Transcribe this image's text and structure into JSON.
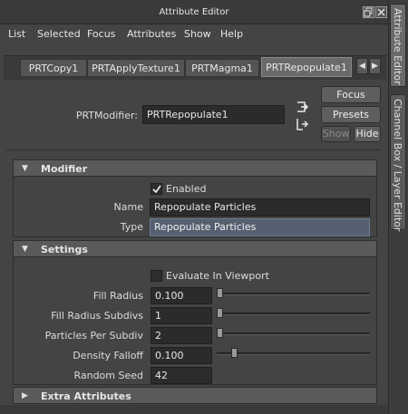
{
  "window": {
    "title": "Attribute Editor"
  },
  "side_tabs": {
    "attribute_editor": "Attribute Editor",
    "channel_box": "Channel Box / Layer Editor"
  },
  "menu": {
    "list": "List",
    "selected": "Selected",
    "focus": "Focus",
    "attributes": "Attributes",
    "show": "Show",
    "help": "Help"
  },
  "tabs": [
    "PRTCopy1",
    "PRTApplyTexture1",
    "PRTMagma1",
    "PRTRepopulate1"
  ],
  "active_tab": "PRTRepopulate1",
  "node": {
    "label": "PRTModifier:",
    "value": "PRTRepopulate1"
  },
  "buttons": {
    "focus": "Focus",
    "presets": "Presets",
    "show": "Show",
    "hide": "Hide"
  },
  "modifier": {
    "title": "Modifier",
    "enabled_label": "Enabled",
    "enabled": true,
    "name_label": "Name",
    "name_value": "Repopulate Particles",
    "type_label": "Type",
    "type_value": "Repopulate Particles"
  },
  "settings": {
    "title": "Settings",
    "evaluate_label": "Evaluate In Viewport",
    "evaluate": false,
    "fill_radius": {
      "label": "Fill Radius",
      "value": "0.100",
      "slider": 0.0
    },
    "fill_radius_subdivs": {
      "label": "Fill Radius Subdivs",
      "value": "1",
      "slider": 0.0
    },
    "particles_per_subdiv": {
      "label": "Particles Per Subdiv",
      "value": "2",
      "slider": 0.0
    },
    "density_falloff": {
      "label": "Density Falloff",
      "value": "0.100",
      "slider": 0.1
    },
    "random_seed": {
      "label": "Random Seed",
      "value": "42"
    }
  },
  "extra": {
    "title": "Extra Attributes"
  },
  "colors": {
    "background": "#444444",
    "field": "#2b2b2b",
    "selected_field": "#556070",
    "header": "#5a5a5a"
  },
  "icons": [
    "pin-icon",
    "load-selected-icon",
    "close-icon",
    "float-icon",
    "expand-icon",
    "collapse-icon",
    "checkmark-icon",
    "scroll-left-icon",
    "scroll-right-icon"
  ]
}
